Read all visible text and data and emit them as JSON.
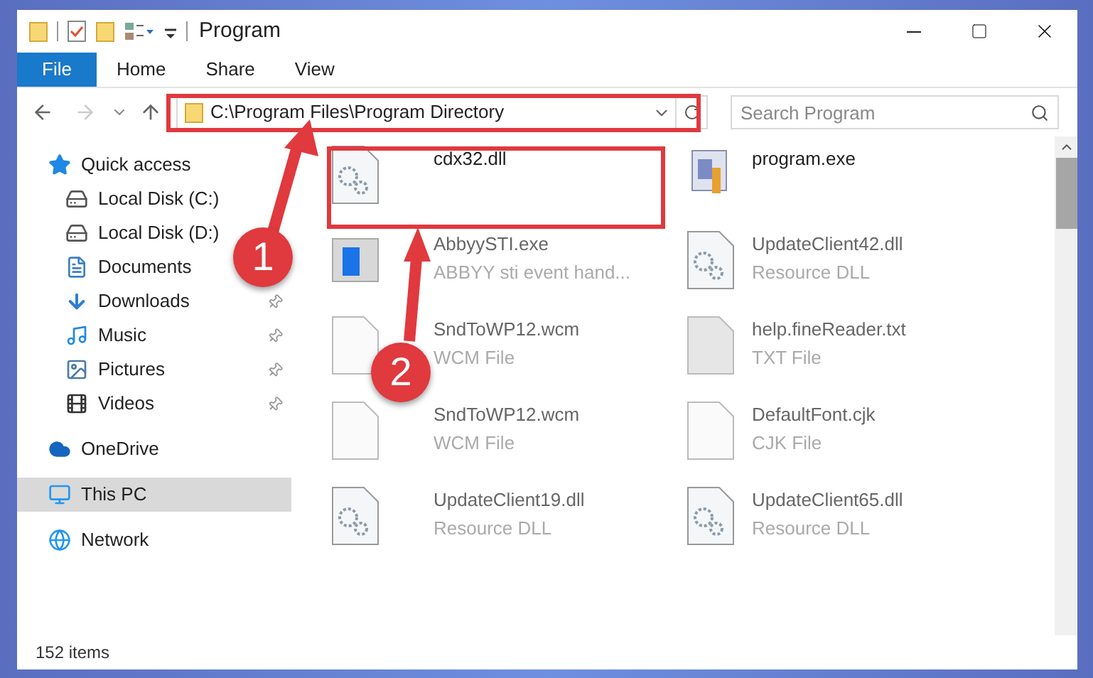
{
  "window": {
    "title": "Program"
  },
  "ribbon_tabs": [
    {
      "label": "File",
      "selected": true
    },
    {
      "label": "Home",
      "selected": false
    },
    {
      "label": "Share",
      "selected": false
    },
    {
      "label": "View",
      "selected": false
    }
  ],
  "address_bar": {
    "path": "C:\\Program Files\\Program Directory"
  },
  "search": {
    "placeholder": "Search Program"
  },
  "sidebar": {
    "items": [
      {
        "label": "Quick access",
        "kind": "quick",
        "pinned": false,
        "selected": false
      },
      {
        "label": "Local Disk (C:)",
        "kind": "diskc",
        "pinned": false,
        "selected": false
      },
      {
        "label": "Local Disk (D:)",
        "kind": "disk",
        "pinned": false,
        "selected": false
      },
      {
        "label": "Documents",
        "kind": "documents",
        "pinned": false,
        "selected": false
      },
      {
        "label": "Downloads",
        "kind": "downloads",
        "pinned": true,
        "selected": false
      },
      {
        "label": "Music",
        "kind": "music",
        "pinned": true,
        "selected": false
      },
      {
        "label": "Pictures",
        "kind": "pictures",
        "pinned": true,
        "selected": false
      },
      {
        "label": "Videos",
        "kind": "videos",
        "pinned": true,
        "selected": false
      },
      {
        "label": "OneDrive",
        "kind": "onedrive",
        "pinned": false,
        "selected": false
      },
      {
        "label": "This PC",
        "kind": "pc",
        "pinned": false,
        "selected": true
      },
      {
        "label": "Network",
        "kind": "network",
        "pinned": false,
        "selected": false
      }
    ]
  },
  "files": [
    {
      "name": "cdx32.dll",
      "kind": "dll"
    },
    {
      "name": "program.exe",
      "kind": "program"
    },
    {
      "name": "AbbyySTI.exe",
      "type": "ABBYY sti event hand...",
      "kind": "app"
    },
    {
      "name": "UpdateClient42.dll",
      "type": "Resource DLL",
      "kind": "dll"
    },
    {
      "name": "SndToWP12.wcm",
      "type": "WCM File",
      "kind": "file"
    },
    {
      "name": "help.fineReader.txt",
      "type": "TXT File",
      "kind": "txt"
    },
    {
      "name": "SndToWP12.wcm",
      "type": "WCM File",
      "kind": "file"
    },
    {
      "name": "DefaultFont.cjk",
      "type": "CJK File",
      "kind": "file"
    },
    {
      "name": "UpdateClient19.dll",
      "type": "Resource DLL",
      "kind": "dll"
    },
    {
      "name": "UpdateClient65.dll",
      "type": "Resource DLL",
      "kind": "dll"
    }
  ],
  "status_bar": {
    "item_count": "152 items"
  },
  "callouts": [
    {
      "number": "1"
    },
    {
      "number": "2"
    }
  ]
}
